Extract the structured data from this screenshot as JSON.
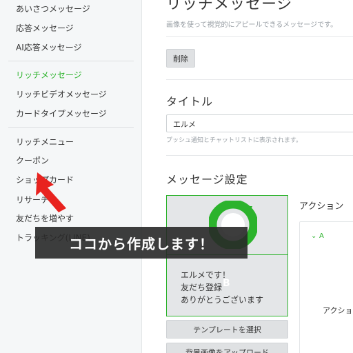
{
  "sidebar": {
    "items": [
      {
        "label": "あいさつメッセージ",
        "active": false
      },
      {
        "label": "応答メッセージ",
        "active": false
      },
      {
        "label": "AI応答メッセージ",
        "active": false
      },
      {
        "label": "リッチメッセージ",
        "active": true
      },
      {
        "label": "リッチビデオメッセージ",
        "active": false
      },
      {
        "label": "カードタイプメッセージ",
        "active": false
      },
      {
        "label": "リッチメニュー",
        "active": false
      },
      {
        "label": "クーポン",
        "active": false
      },
      {
        "label": "ショップカード",
        "active": false
      },
      {
        "label": "リサーチ",
        "active": false
      },
      {
        "label": "友だちを増やす",
        "active": false
      },
      {
        "label": "トラッキング(LINE)",
        "active": false
      }
    ]
  },
  "main": {
    "title": "リッチメッセージ",
    "subtitle": "画像を使って視覚的にアピールできるメッセージです。",
    "delete_label": "削除",
    "title_section": {
      "heading": "タイトル",
      "value": "エルメ",
      "help": "プッシュ通知とチャットリストに表示されます。"
    },
    "message_settings": {
      "heading": "メッセージ設定",
      "cell_a": "A",
      "cell_b": "B",
      "preview_text": "エルメです！\n友だち登録\nありがとうございます",
      "template_button": "テンプレートを選択",
      "upload_button": "背景画像をアップロード"
    },
    "action": {
      "label": "アクション",
      "item": "A",
      "row_label": "アクショ"
    }
  },
  "overlay": {
    "banner": "ココから作成します！"
  },
  "colors": {
    "accent": "#2cb32c",
    "arrow": "#e8231f",
    "banner_bg": "#2a2a2a"
  }
}
